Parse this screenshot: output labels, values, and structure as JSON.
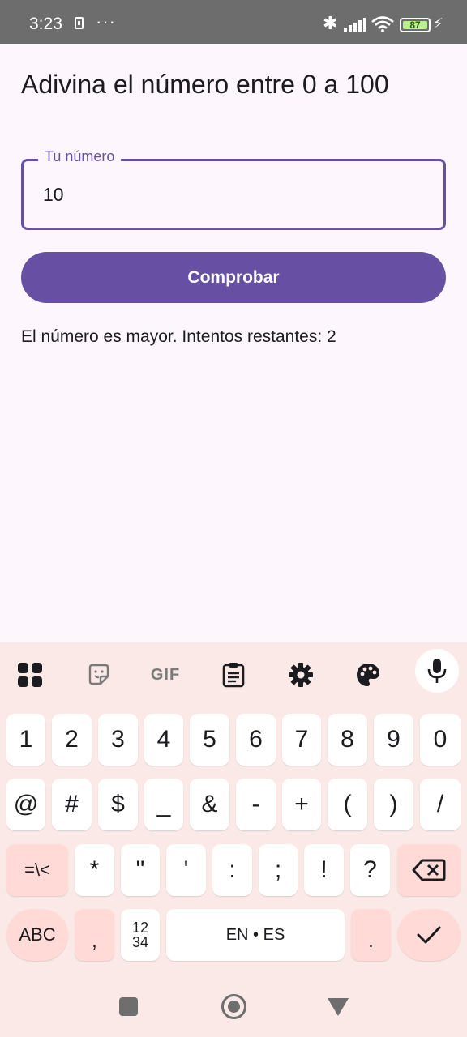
{
  "status_bar": {
    "time": "3:23",
    "more": "···",
    "bluetooth": "✱",
    "battery": "87",
    "charging": "⚡"
  },
  "app": {
    "title": "Adivina el número entre 0 a 100",
    "input_label": "Tu número",
    "input_value": "10",
    "button_label": "Comprobar",
    "result_text": "El número es mayor. Intentos restantes: 2"
  },
  "keyboard": {
    "toolbar_icons": [
      "apps-icon",
      "sticker-icon",
      "gif-icon",
      "clipboard-icon",
      "settings-icon",
      "theme-palette-icon",
      "microphone-icon"
    ],
    "gif_label": "GIF",
    "row1": [
      "1",
      "2",
      "3",
      "4",
      "5",
      "6",
      "7",
      "8",
      "9",
      "0"
    ],
    "row2": [
      "@",
      "#",
      "$",
      "_",
      "&",
      "-",
      "+",
      "(",
      ")",
      "/"
    ],
    "row3": [
      "=\\<",
      "*",
      "\"",
      "'",
      ":",
      ";",
      "!",
      "?"
    ],
    "abc": "ABC",
    "comma": ",",
    "numpad_top": "12",
    "numpad_bottom": "34",
    "space": "EN • ES",
    "period": ".",
    "enter_icon": "check-icon",
    "backspace_icon": "backspace-icon"
  },
  "nav_bar": {
    "icons": [
      "recents-icon",
      "home-icon",
      "back-icon"
    ]
  }
}
